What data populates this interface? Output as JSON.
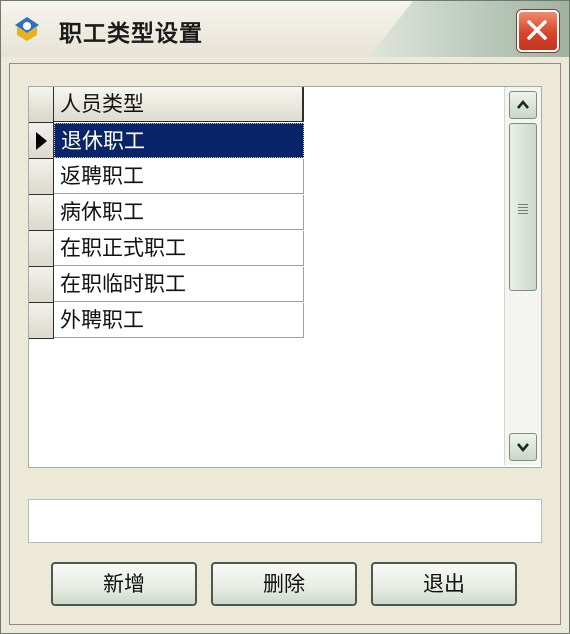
{
  "window": {
    "title": "职工类型设置",
    "app_icon": "app-logo-icon",
    "close_icon": "close-icon"
  },
  "grid": {
    "column_header": "人员类型",
    "rows": [
      "退休职工",
      "返聘职工",
      "病休职工",
      "在职正式职工",
      "在职临时职工",
      "外聘职工"
    ],
    "selected_index": 0
  },
  "text_field": {
    "value": ""
  },
  "buttons": {
    "add": "新增",
    "delete": "删除",
    "exit": "退出"
  },
  "colors": {
    "selection": "#0a246a",
    "close_button": "#d8452c"
  }
}
